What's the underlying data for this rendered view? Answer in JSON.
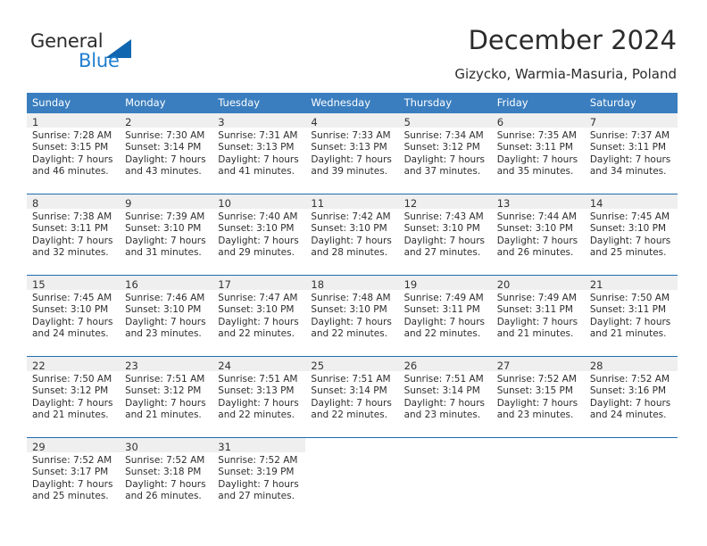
{
  "brand": {
    "name_part1": "General",
    "name_part2": "Blue",
    "logo_icon": "triangle-logo-icon",
    "accent_color": "#1166b0"
  },
  "header": {
    "title": "December 2024",
    "subtitle": "Gizycko, Warmia-Masuria, Poland"
  },
  "calendar": {
    "header_color": "#3a7ebf",
    "daynum_band_color": "#efefef",
    "week_divider_color": "#1f6cb0",
    "weekday_headers": [
      "Sunday",
      "Monday",
      "Tuesday",
      "Wednesday",
      "Thursday",
      "Friday",
      "Saturday"
    ],
    "weeks": [
      [
        {
          "day": "1",
          "sunrise": "Sunrise: 7:28 AM",
          "sunset": "Sunset: 3:15 PM",
          "daylight1": "Daylight: 7 hours",
          "daylight2": "and 46 minutes."
        },
        {
          "day": "2",
          "sunrise": "Sunrise: 7:30 AM",
          "sunset": "Sunset: 3:14 PM",
          "daylight1": "Daylight: 7 hours",
          "daylight2": "and 43 minutes."
        },
        {
          "day": "3",
          "sunrise": "Sunrise: 7:31 AM",
          "sunset": "Sunset: 3:13 PM",
          "daylight1": "Daylight: 7 hours",
          "daylight2": "and 41 minutes."
        },
        {
          "day": "4",
          "sunrise": "Sunrise: 7:33 AM",
          "sunset": "Sunset: 3:13 PM",
          "daylight1": "Daylight: 7 hours",
          "daylight2": "and 39 minutes."
        },
        {
          "day": "5",
          "sunrise": "Sunrise: 7:34 AM",
          "sunset": "Sunset: 3:12 PM",
          "daylight1": "Daylight: 7 hours",
          "daylight2": "and 37 minutes."
        },
        {
          "day": "6",
          "sunrise": "Sunrise: 7:35 AM",
          "sunset": "Sunset: 3:11 PM",
          "daylight1": "Daylight: 7 hours",
          "daylight2": "and 35 minutes."
        },
        {
          "day": "7",
          "sunrise": "Sunrise: 7:37 AM",
          "sunset": "Sunset: 3:11 PM",
          "daylight1": "Daylight: 7 hours",
          "daylight2": "and 34 minutes."
        }
      ],
      [
        {
          "day": "8",
          "sunrise": "Sunrise: 7:38 AM",
          "sunset": "Sunset: 3:11 PM",
          "daylight1": "Daylight: 7 hours",
          "daylight2": "and 32 minutes."
        },
        {
          "day": "9",
          "sunrise": "Sunrise: 7:39 AM",
          "sunset": "Sunset: 3:10 PM",
          "daylight1": "Daylight: 7 hours",
          "daylight2": "and 31 minutes."
        },
        {
          "day": "10",
          "sunrise": "Sunrise: 7:40 AM",
          "sunset": "Sunset: 3:10 PM",
          "daylight1": "Daylight: 7 hours",
          "daylight2": "and 29 minutes."
        },
        {
          "day": "11",
          "sunrise": "Sunrise: 7:42 AM",
          "sunset": "Sunset: 3:10 PM",
          "daylight1": "Daylight: 7 hours",
          "daylight2": "and 28 minutes."
        },
        {
          "day": "12",
          "sunrise": "Sunrise: 7:43 AM",
          "sunset": "Sunset: 3:10 PM",
          "daylight1": "Daylight: 7 hours",
          "daylight2": "and 27 minutes."
        },
        {
          "day": "13",
          "sunrise": "Sunrise: 7:44 AM",
          "sunset": "Sunset: 3:10 PM",
          "daylight1": "Daylight: 7 hours",
          "daylight2": "and 26 minutes."
        },
        {
          "day": "14",
          "sunrise": "Sunrise: 7:45 AM",
          "sunset": "Sunset: 3:10 PM",
          "daylight1": "Daylight: 7 hours",
          "daylight2": "and 25 minutes."
        }
      ],
      [
        {
          "day": "15",
          "sunrise": "Sunrise: 7:45 AM",
          "sunset": "Sunset: 3:10 PM",
          "daylight1": "Daylight: 7 hours",
          "daylight2": "and 24 minutes."
        },
        {
          "day": "16",
          "sunrise": "Sunrise: 7:46 AM",
          "sunset": "Sunset: 3:10 PM",
          "daylight1": "Daylight: 7 hours",
          "daylight2": "and 23 minutes."
        },
        {
          "day": "17",
          "sunrise": "Sunrise: 7:47 AM",
          "sunset": "Sunset: 3:10 PM",
          "daylight1": "Daylight: 7 hours",
          "daylight2": "and 22 minutes."
        },
        {
          "day": "18",
          "sunrise": "Sunrise: 7:48 AM",
          "sunset": "Sunset: 3:10 PM",
          "daylight1": "Daylight: 7 hours",
          "daylight2": "and 22 minutes."
        },
        {
          "day": "19",
          "sunrise": "Sunrise: 7:49 AM",
          "sunset": "Sunset: 3:11 PM",
          "daylight1": "Daylight: 7 hours",
          "daylight2": "and 22 minutes."
        },
        {
          "day": "20",
          "sunrise": "Sunrise: 7:49 AM",
          "sunset": "Sunset: 3:11 PM",
          "daylight1": "Daylight: 7 hours",
          "daylight2": "and 21 minutes."
        },
        {
          "day": "21",
          "sunrise": "Sunrise: 7:50 AM",
          "sunset": "Sunset: 3:11 PM",
          "daylight1": "Daylight: 7 hours",
          "daylight2": "and 21 minutes."
        }
      ],
      [
        {
          "day": "22",
          "sunrise": "Sunrise: 7:50 AM",
          "sunset": "Sunset: 3:12 PM",
          "daylight1": "Daylight: 7 hours",
          "daylight2": "and 21 minutes."
        },
        {
          "day": "23",
          "sunrise": "Sunrise: 7:51 AM",
          "sunset": "Sunset: 3:12 PM",
          "daylight1": "Daylight: 7 hours",
          "daylight2": "and 21 minutes."
        },
        {
          "day": "24",
          "sunrise": "Sunrise: 7:51 AM",
          "sunset": "Sunset: 3:13 PM",
          "daylight1": "Daylight: 7 hours",
          "daylight2": "and 22 minutes."
        },
        {
          "day": "25",
          "sunrise": "Sunrise: 7:51 AM",
          "sunset": "Sunset: 3:14 PM",
          "daylight1": "Daylight: 7 hours",
          "daylight2": "and 22 minutes."
        },
        {
          "day": "26",
          "sunrise": "Sunrise: 7:51 AM",
          "sunset": "Sunset: 3:14 PM",
          "daylight1": "Daylight: 7 hours",
          "daylight2": "and 23 minutes."
        },
        {
          "day": "27",
          "sunrise": "Sunrise: 7:52 AM",
          "sunset": "Sunset: 3:15 PM",
          "daylight1": "Daylight: 7 hours",
          "daylight2": "and 23 minutes."
        },
        {
          "day": "28",
          "sunrise": "Sunrise: 7:52 AM",
          "sunset": "Sunset: 3:16 PM",
          "daylight1": "Daylight: 7 hours",
          "daylight2": "and 24 minutes."
        }
      ],
      [
        {
          "day": "29",
          "sunrise": "Sunrise: 7:52 AM",
          "sunset": "Sunset: 3:17 PM",
          "daylight1": "Daylight: 7 hours",
          "daylight2": "and 25 minutes."
        },
        {
          "day": "30",
          "sunrise": "Sunrise: 7:52 AM",
          "sunset": "Sunset: 3:18 PM",
          "daylight1": "Daylight: 7 hours",
          "daylight2": "and 26 minutes."
        },
        {
          "day": "31",
          "sunrise": "Sunrise: 7:52 AM",
          "sunset": "Sunset: 3:19 PM",
          "daylight1": "Daylight: 7 hours",
          "daylight2": "and 27 minutes."
        },
        null,
        null,
        null,
        null
      ]
    ]
  }
}
